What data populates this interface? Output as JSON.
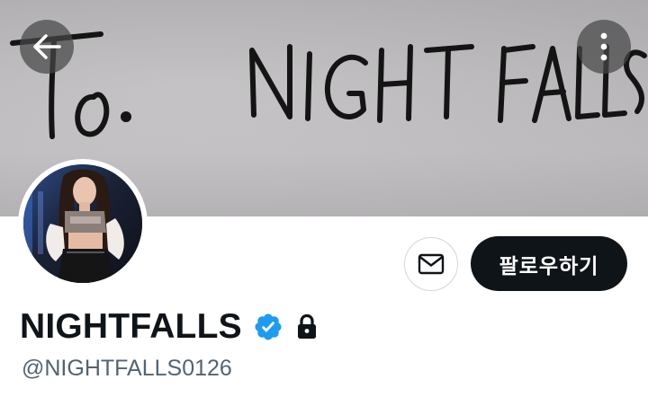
{
  "header": {
    "banner_text_left": "To.",
    "banner_text_right": "NIGHT FALLS",
    "back_icon": "arrow-left-icon",
    "more_icon": "more-vertical-icon"
  },
  "profile": {
    "display_name": "NIGHTFALLS",
    "handle": "@NIGHTFALLS0126",
    "verified_icon": "verified-badge-icon",
    "protected_icon": "lock-icon"
  },
  "actions": {
    "message_icon": "mail-icon",
    "follow_label": "팔로우하기"
  },
  "colors": {
    "follow_bg": "#0f1419",
    "verified": "#1d9bf0",
    "handle": "#536471"
  }
}
